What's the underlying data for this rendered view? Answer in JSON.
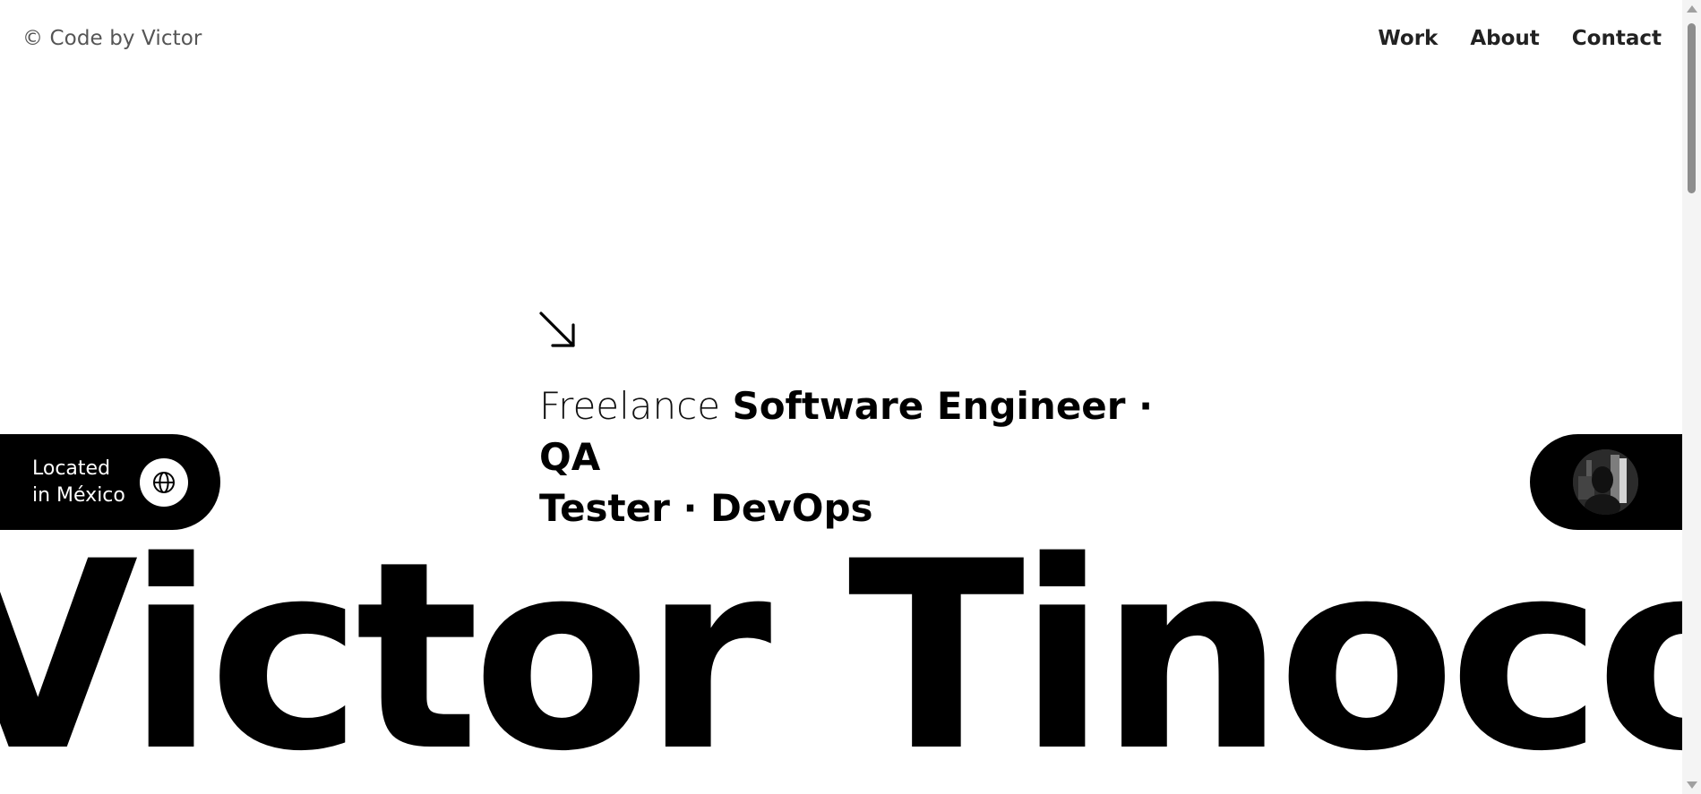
{
  "header": {
    "logo": "© Code by Victor",
    "nav": [
      "Work",
      "About",
      "Contact"
    ]
  },
  "hero": {
    "arrow_icon": "arrow-down-right-icon",
    "tagline_light": "Freelance",
    "tagline_bold_line1": "Software Engineer · QA",
    "tagline_bold_line2": "Tester · DevOps",
    "location_line1": "Located",
    "location_line2": "in México",
    "location_icon": "globe-icon",
    "marquee_text": "Victor Tinoco - V"
  },
  "colors": {
    "background": "#ffffff",
    "text": "#000000",
    "logo_text": "#555555",
    "pill": "#000000"
  }
}
